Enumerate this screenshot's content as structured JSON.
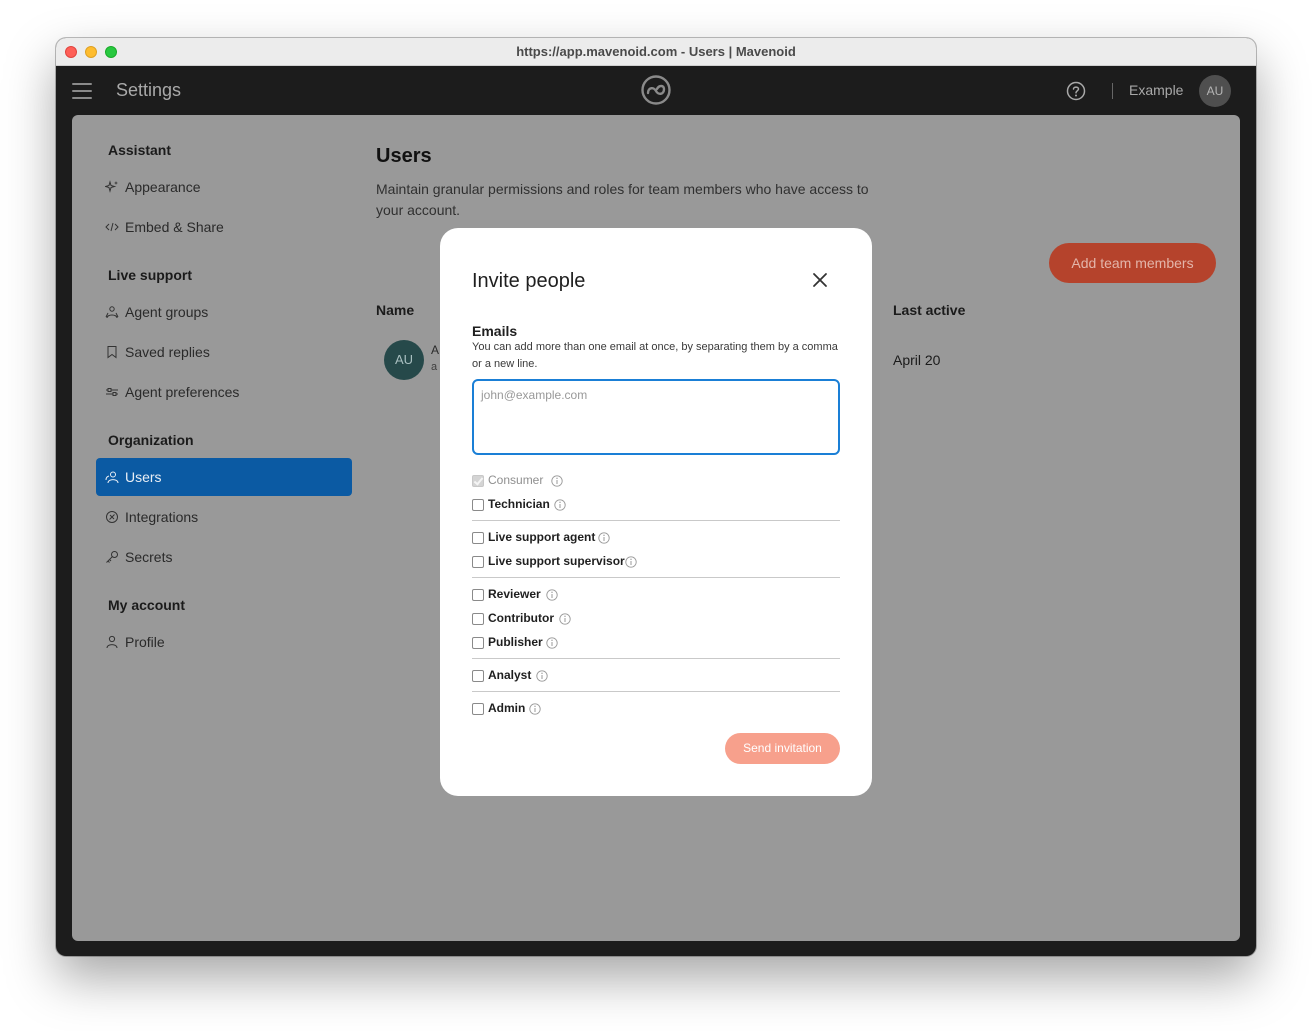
{
  "window": {
    "url": "https://app.mavenoid.com - Users | Mavenoid"
  },
  "appbar": {
    "title": "Settings",
    "org_name": "Example",
    "avatar_initials": "AU"
  },
  "sidebar": {
    "sections": [
      {
        "title": "Assistant",
        "items": [
          {
            "label": "Appearance",
            "icon": "sparkle-icon"
          },
          {
            "label": "Embed & Share",
            "icon": "code-icon"
          }
        ]
      },
      {
        "title": "Live support",
        "items": [
          {
            "label": "Agent groups",
            "icon": "group-icon"
          },
          {
            "label": "Saved replies",
            "icon": "bookmark-icon"
          },
          {
            "label": "Agent preferences",
            "icon": "sliders-icon"
          }
        ]
      },
      {
        "title": "Organization",
        "items": [
          {
            "label": "Users",
            "icon": "users-icon",
            "active": true
          },
          {
            "label": "Integrations",
            "icon": "integrations-icon"
          },
          {
            "label": "Secrets",
            "icon": "key-icon"
          }
        ]
      },
      {
        "title": "My account",
        "items": [
          {
            "label": "Profile",
            "icon": "person-icon"
          }
        ]
      }
    ]
  },
  "main": {
    "title": "Users",
    "description": "Maintain granular permissions and roles for team members who have access to your account.",
    "add_button": "Add team members",
    "columns": {
      "name": "Name",
      "last_active": "Last active"
    },
    "rows": [
      {
        "avatar": "AU",
        "name_peek": "A",
        "sub_peek": "a",
        "last_active": "April 20"
      }
    ]
  },
  "modal": {
    "title": "Invite people",
    "emails_label": "Emails",
    "emails_help": "You can add more than one email at once, by separating them by a comma or a new line.",
    "emails_placeholder": "john@example.com",
    "roles": [
      {
        "label": "Consumer",
        "checked": true,
        "disabled": true
      },
      {
        "label": "Technician",
        "checked": false
      },
      {
        "label": "Live support agent",
        "checked": false
      },
      {
        "label": "Live support supervisor",
        "checked": false
      },
      {
        "label": "Reviewer",
        "checked": false
      },
      {
        "label": "Contributor",
        "checked": false
      },
      {
        "label": "Publisher",
        "checked": false
      },
      {
        "label": "Analyst",
        "checked": false
      },
      {
        "label": "Admin",
        "checked": false
      }
    ],
    "send_button": "Send invitation"
  },
  "colors": {
    "accent_blue": "#0b5aa3",
    "primary_button": "#b5432c",
    "send_button_disabled": "#f7a08c",
    "focus_border": "#1a7fd6"
  }
}
